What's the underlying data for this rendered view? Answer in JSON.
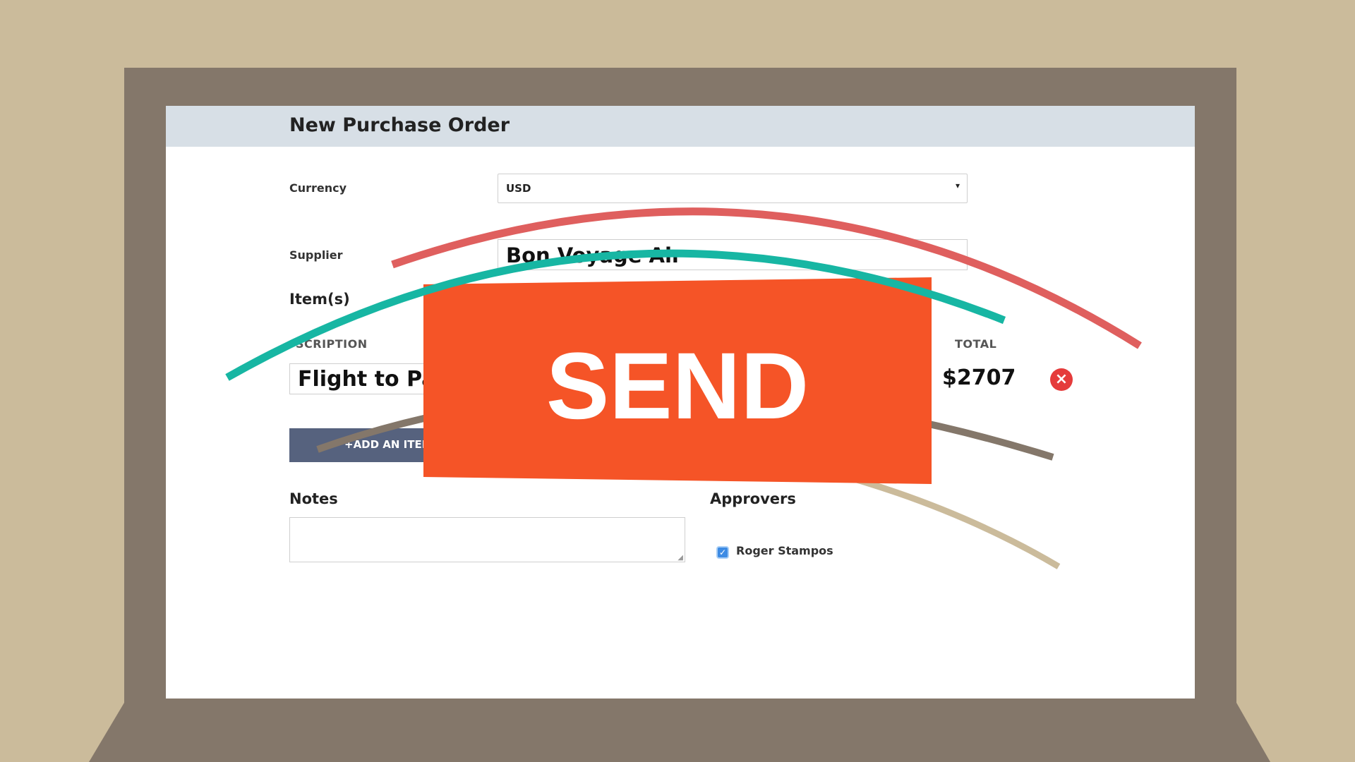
{
  "form": {
    "title": "New Purchase Order",
    "currency_label": "Currency",
    "currency_value": "USD",
    "supplier_label": "Supplier",
    "supplier_value": "Bon Voyage Air",
    "items_label": "Item(s)",
    "description_header": "SCRIPTION",
    "total_header": "TOTAL",
    "item_description": "Flight to Par",
    "item_total": "$2707",
    "add_item_label": "+ADD AN ITEM",
    "notes_label": "Notes",
    "approvers_label": "Approvers",
    "approver_name": "Roger Stampos",
    "approver_checked": true
  },
  "overlay": {
    "send_label": "SEND"
  },
  "colors": {
    "background": "#cbbb9b",
    "laptop": "#84776a",
    "send": "#f55427",
    "arc_red": "#df5f5e",
    "arc_teal": "#17b6a3",
    "arc_brown": "#84776a",
    "arc_tan": "#cbbb9b"
  },
  "icons": {
    "dropdown": "chevron-down-icon",
    "remove": "close-circle-icon",
    "checkbox": "checkbox-checked-icon"
  }
}
